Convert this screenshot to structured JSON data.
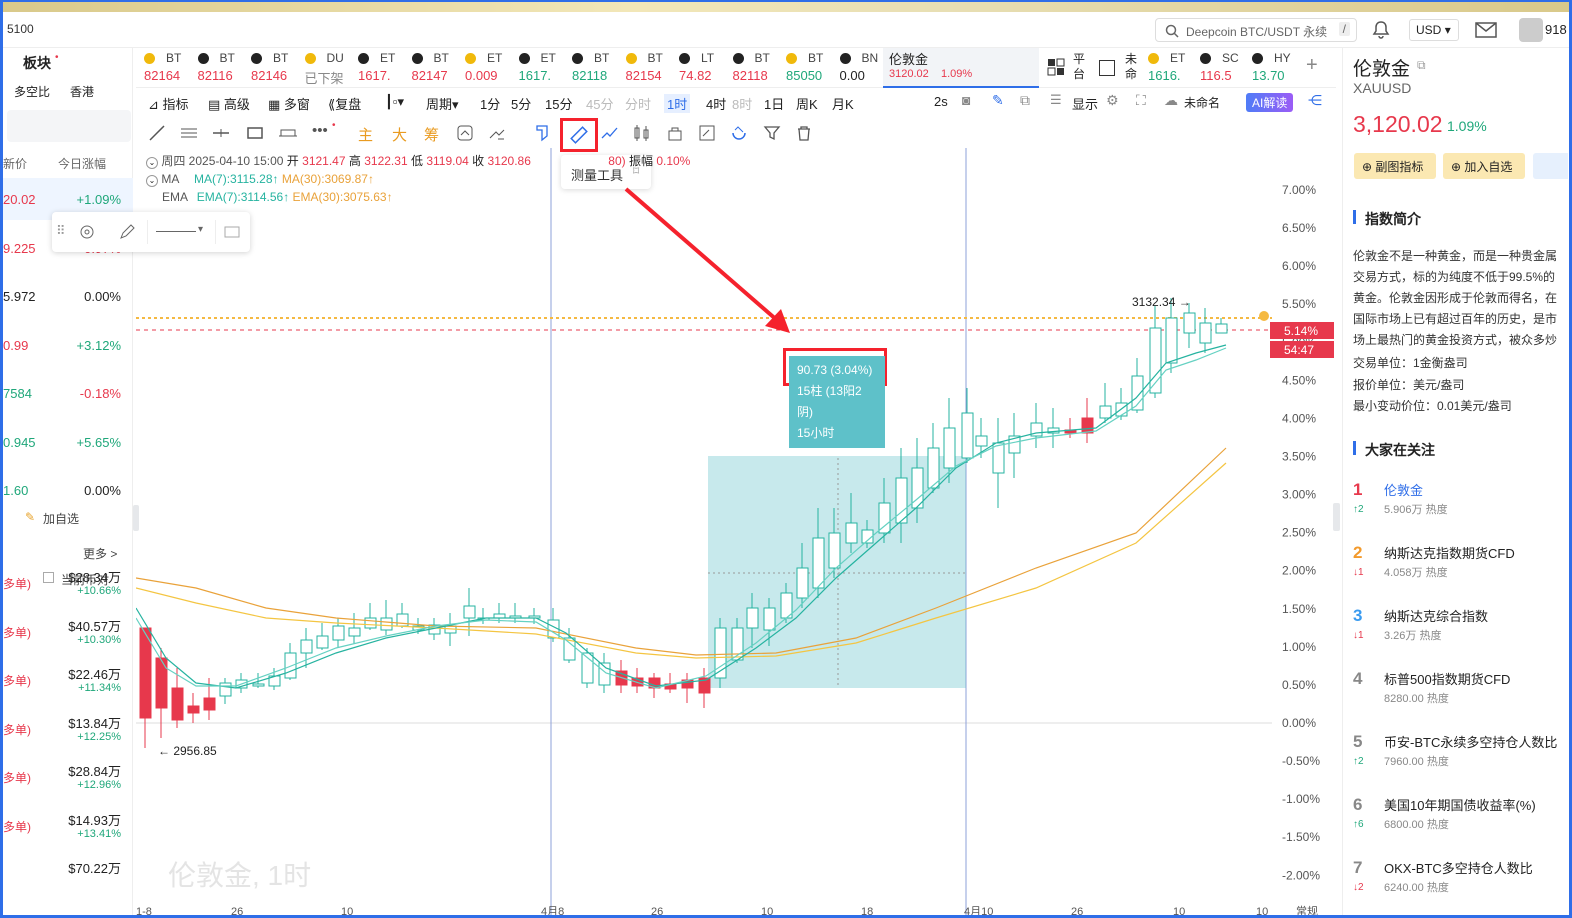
{
  "topbar": {
    "left_number": "5100",
    "search_placeholder": "Deepcoin BTC/USDT 永续",
    "search_shortcut": "/",
    "currency": "USD",
    "avatar_text": "918"
  },
  "left_panel": {
    "section_title": "板块",
    "filters": [
      "多空比",
      "香港"
    ],
    "col_headers": [
      "新价",
      "今日涨幅"
    ],
    "rows": [
      {
        "price": "20.02",
        "change": "+1.09%",
        "price_color": "#e7384c",
        "change_color": "#1fa77a"
      },
      {
        "price": "9.225",
        "change": "-0.97%",
        "price_color": "#e7384c",
        "change_color": "#e7384c"
      },
      {
        "price": "5.972",
        "change": "0.00%",
        "price_color": "#222222",
        "change_color": "#222222"
      },
      {
        "price": "0.99",
        "change": "+3.12%",
        "price_color": "#e7384c",
        "change_color": "#1fa77a"
      },
      {
        "price": "7584",
        "change": "-0.18%",
        "price_color": "#1fa77a",
        "change_color": "#e7384c"
      },
      {
        "price": "0.945",
        "change": "+5.65%",
        "price_color": "#1fa77a",
        "change_color": "#1fa77a"
      },
      {
        "price": "1.60",
        "change": "0.00%",
        "price_color": "#1fa77a",
        "change_color": "#222222"
      }
    ],
    "add_watch": "加自选",
    "more": "更多 >",
    "current_coin": "当前币对",
    "flows": [
      {
        "tag": "多单)",
        "amount": "$28.34万",
        "pct": "+10.66%"
      },
      {
        "tag": "多单)",
        "amount": "$40.57万",
        "pct": "+10.30%"
      },
      {
        "tag": "多单)",
        "amount": "$22.46万",
        "pct": "+11.34%"
      },
      {
        "tag": "多单)",
        "amount": "$13.84万",
        "pct": "+12.25%"
      },
      {
        "tag": "多单)",
        "amount": "$28.84万",
        "pct": "+12.96%"
      },
      {
        "tag": "多单)",
        "amount": "$14.93万",
        "pct": "+13.41%"
      },
      {
        "tag": "",
        "amount": "$70.22万",
        "pct": ""
      }
    ]
  },
  "tickers": [
    {
      "name": "BT",
      "price": "82164",
      "color": "#e7384c"
    },
    {
      "name": "BT",
      "price": "82116",
      "color": "#e7384c"
    },
    {
      "name": "BT",
      "price": "82146",
      "color": "#e7384c"
    },
    {
      "name": "DU",
      "price": "已下架",
      "color": "#888888"
    },
    {
      "name": "ET",
      "price": "1617.",
      "color": "#e7384c"
    },
    {
      "name": "BT",
      "price": "82147",
      "color": "#e7384c"
    },
    {
      "name": "ET",
      "price": "0.009",
      "color": "#e7384c"
    },
    {
      "name": "ET",
      "price": "1617.",
      "color": "#1fa77a"
    },
    {
      "name": "BT",
      "price": "82118",
      "color": "#1fa77a"
    },
    {
      "name": "BT",
      "price": "82154",
      "color": "#e7384c"
    },
    {
      "name": "LT",
      "price": "74.82",
      "color": "#e7384c"
    },
    {
      "name": "BT",
      "price": "82118",
      "color": "#e7384c"
    },
    {
      "name": "BT",
      "price": "85050",
      "color": "#1fa77a"
    },
    {
      "name": "BN",
      "price": "0.00",
      "color": "#222222"
    }
  ],
  "active_ticker": {
    "name": "伦敦金",
    "price": "3120.02",
    "change": "1.09%"
  },
  "tickers_right": [
    {
      "name": "平台",
      "price": ""
    },
    {
      "name": "未命",
      "price": ""
    },
    {
      "name": "ET",
      "price": "1616.",
      "color": "#1fa77a"
    },
    {
      "name": "SC",
      "price": "116.5",
      "color": "#e7384c"
    },
    {
      "name": "HY",
      "price": "13.70",
      "color": "#1fa77a"
    }
  ],
  "toolbar": {
    "items": [
      "指标",
      "高级",
      "多窗",
      "复盘",
      "",
      "周期"
    ],
    "periods": [
      "1分",
      "5分",
      "15分",
      "45分",
      "分时",
      "1时",
      "4时",
      "8时",
      "1日",
      "周K",
      "月K"
    ],
    "active_period": "1时",
    "right_items": [
      "2s",
      "显示",
      "未命名",
      "AI解读"
    ]
  },
  "drawing_tools": [
    "主",
    "大",
    "筹"
  ],
  "measure_tooltip": "测量工具",
  "legend": {
    "line1": {
      "label": "周四 2025-04-10 15:00",
      "open_l": "开",
      "open": "3121.47",
      "high_l": "高",
      "high": "3122.31",
      "low_l": "低",
      "low": "3119.04",
      "close_l": "收",
      "close": "3120.86",
      "extra": "80)",
      "amp_l": "振幅",
      "amp": "0.10%"
    },
    "ma": {
      "label": "MA",
      "ma7": "MA(7):3115.28",
      "ma30": "MA(30):3069.87"
    },
    "ema": {
      "label": "EMA",
      "ema7": "EMA(7):3114.56",
      "ema30": "EMA(30):3075.63"
    }
  },
  "chart": {
    "y_ticks": [
      "7.00%",
      "6.50%",
      "6.00%",
      "5.50%",
      "5.00%",
      "4.50%",
      "4.00%",
      "3.50%",
      "3.00%",
      "2.50%",
      "2.00%",
      "1.50%",
      "1.00%",
      "0.50%",
      "0.00%",
      "-0.50%",
      "-1.00%",
      "-1.50%",
      "-2.00%"
    ],
    "price_tag": "5.14%",
    "countdown": "54:47",
    "high_label": "3132.34 →",
    "low_label": "← 2956.85",
    "watermark": "伦敦金, 1时",
    "measure": {
      "line1": "90.73 (3.04%)",
      "line2": "15柱 (13阳2阴)",
      "line3": "15小时"
    },
    "x_ticks": [
      "1-8",
      "26",
      "10",
      "4月8",
      "26",
      "10",
      "18",
      "4月10",
      "26",
      "10",
      "10",
      "常规"
    ]
  },
  "right_panel": {
    "title": "伦敦金",
    "symbol": "XAUUSD",
    "price": "3,120.02",
    "change": "1.09%",
    "btn_indicator": "副图指标",
    "btn_watch": "加入自选",
    "section_intro": "指数简介",
    "intro_text": "伦敦金不是一种黄金，而是一种贵金属交易方式，标的为纯度不低于99.5%的黄金。伦敦金因形成于伦敦而得名，在国际市场上已有超过百年的历史，是市场上最热门的黄金投资方式，被众多炒家所追捧。",
    "unit": "交易单位：1金衡盎司",
    "quote_unit": "报价单位：美元/盎司",
    "tick": "最小变动价位：0.01美元/盎司",
    "section_hot": "大家在关注",
    "hot": [
      {
        "rank": "1",
        "title": "伦敦金",
        "heat": "5.906万 热度",
        "chg": "↑2",
        "rank_color": "#e7384c",
        "chg_color": "#1fa77a"
      },
      {
        "rank": "2",
        "title": "纳斯达克指数期货CFD",
        "heat": "4.058万 热度",
        "chg": "↓1",
        "rank_color": "#f39a2c",
        "chg_color": "#e7384c"
      },
      {
        "rank": "3",
        "title": "纳斯达克综合指数",
        "heat": "3.26万 热度",
        "chg": "↓1",
        "rank_color": "#3a9bf0",
        "chg_color": "#e7384c"
      },
      {
        "rank": "4",
        "title": "标普500指数期货CFD",
        "heat": "8280.00 热度",
        "chg": "",
        "rank_color": "#888888",
        "chg_color": "#888888"
      },
      {
        "rank": "5",
        "title": "币安-BTC永续多空持仓人数比",
        "heat": "7960.00 热度",
        "chg": "↑2",
        "rank_color": "#888888",
        "chg_color": "#1fa77a"
      },
      {
        "rank": "6",
        "title": "美国10年期国债收益率(%)",
        "heat": "6800.00 热度",
        "chg": "↑6",
        "rank_color": "#888888",
        "chg_color": "#1fa77a"
      },
      {
        "rank": "7",
        "title": "OKX-BTC多空持仓人数比",
        "heat": "6240.00 热度",
        "chg": "↓2",
        "rank_color": "#888888",
        "chg_color": "#e7384c"
      }
    ]
  },
  "colors": {
    "up": "#1fa77a",
    "down": "#e7384c",
    "accent": "#2f6ee8",
    "highlight": "#f5222d"
  }
}
